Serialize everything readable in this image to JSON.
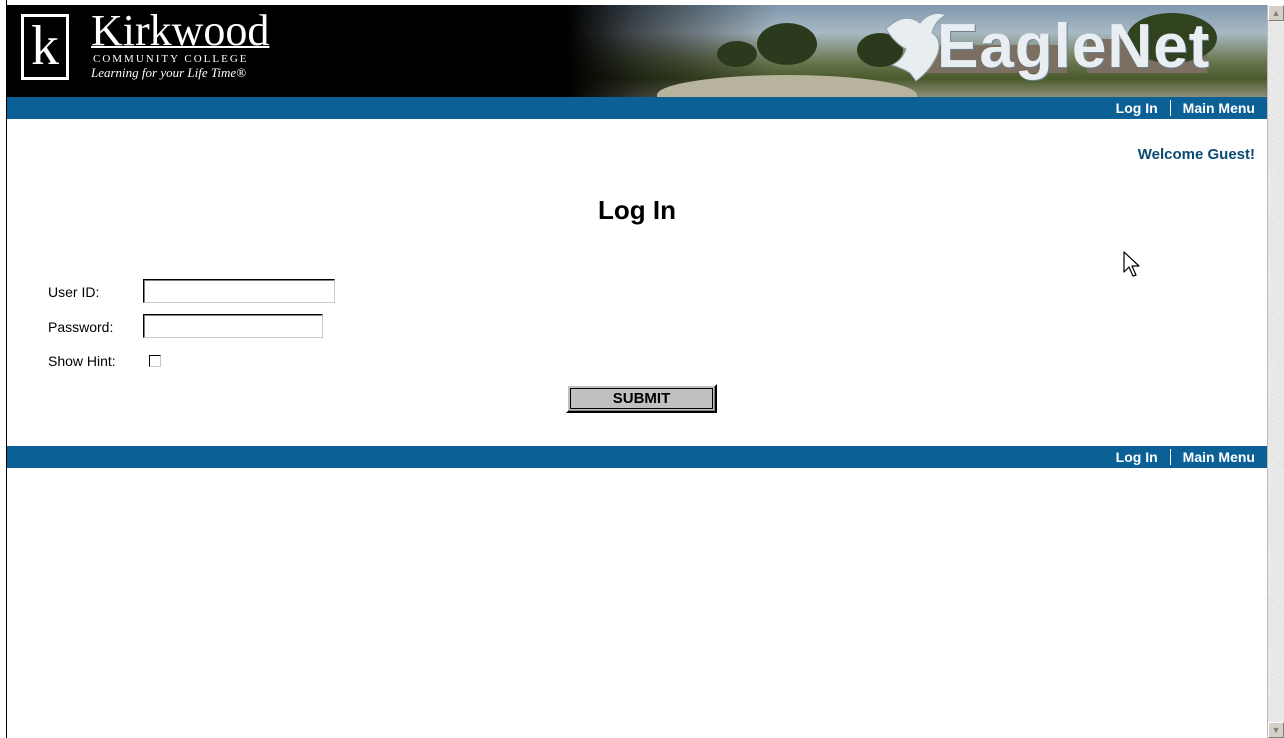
{
  "banner": {
    "logo_letter": "k",
    "brand_name": "Kirkwood",
    "brand_sub": "COMMUNITY COLLEGE",
    "brand_tagline": "Learning for your Life Time®",
    "app_title": "EagleNet"
  },
  "nav": {
    "login": "Log In",
    "main_menu": "Main Menu"
  },
  "welcome": "Welcome Guest!",
  "page_title": "Log In",
  "form": {
    "userid_label": "User ID:",
    "userid_value": "",
    "password_label": "Password:",
    "password_value": "",
    "hint_label": "Show Hint:",
    "hint_checked": false,
    "submit_label": "SUBMIT"
  },
  "icons": {
    "eagle": "eagle-icon",
    "cursor": "mouse-pointer-icon",
    "scroll_up": "arrow-up-icon",
    "scroll_down": "arrow-down-icon"
  },
  "colors": {
    "nav_bar": "#0b6096",
    "welcome_text": "#0b4a72",
    "banner_bg": "#000000"
  }
}
